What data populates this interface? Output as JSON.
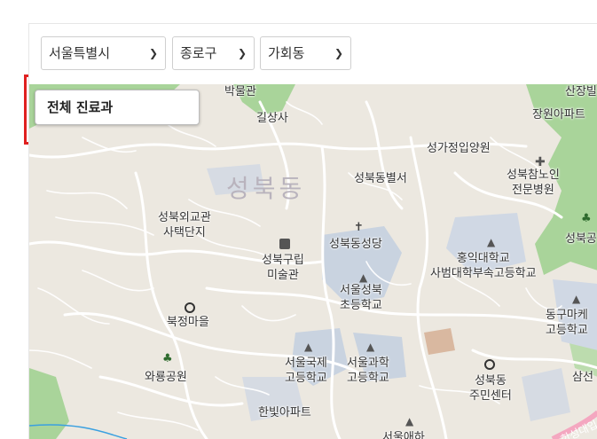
{
  "filters": {
    "region": "서울특별시",
    "district": "종로구",
    "neighborhood": "가회동"
  },
  "department_button": "전체 진료과",
  "map": {
    "district_label": "성북동",
    "labels": {
      "l1": "박물관",
      "l2": "길상사",
      "l3": "산장빌",
      "l4": "장원아파트",
      "l5": "성가정입양원",
      "l6": "성북참노인\n전문병원",
      "l7": "성북동별서",
      "l8": "성북외교관\n사택단지",
      "l9": "성북동성당",
      "l10": "성북공",
      "l11": "성북구립\n미술관",
      "l12": "홍익대학교\n사범대학부속고등학교",
      "l13": "서울성북\n초등학교",
      "l14": "동구마케\n고등학교",
      "l15": "북정마을",
      "l16": "와룡공원",
      "l17": "서울국제\n고등학교",
      "l18": "서울과학\n고등학교",
      "l19": "성북동\n주민센터",
      "l20": "삼선",
      "l21": "한빛아파트",
      "l22": "서울애하",
      "l23": "한성대입"
    }
  }
}
